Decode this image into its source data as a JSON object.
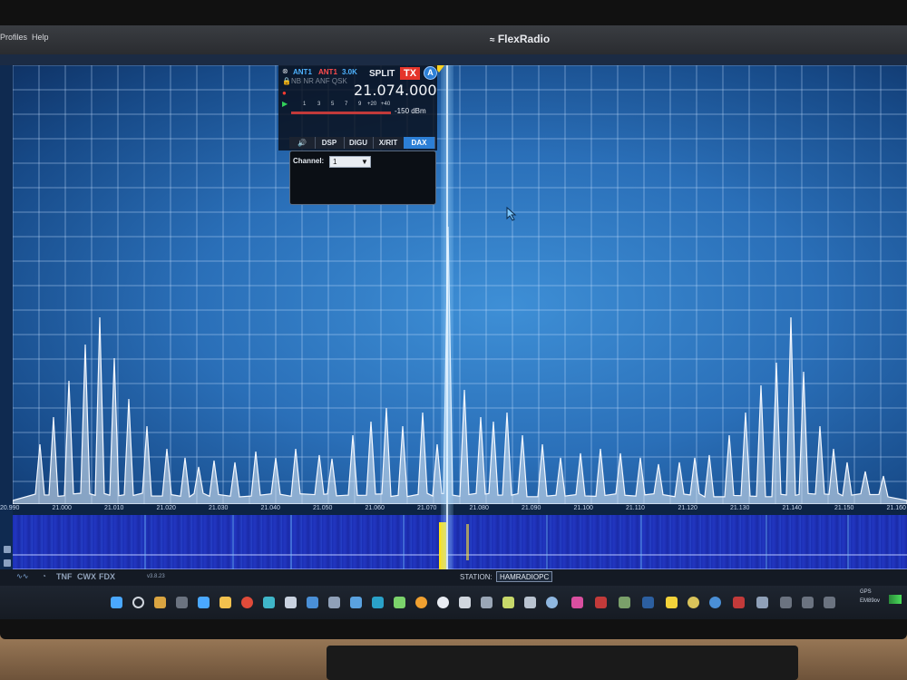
{
  "app": {
    "brand": "FlexRadio",
    "menus": [
      "Profiles",
      "Help"
    ]
  },
  "slice": {
    "rx_ant": "ANT1",
    "tx_ant": "ANT1",
    "filter": "3.0K",
    "flags": "NB NR ANF QSK",
    "split_label": "SPLIT",
    "tx_label": "TX",
    "slice_letter": "A",
    "frequency": "21.074.000",
    "meter_scale": [
      "1",
      "3",
      "5",
      "7",
      "9",
      "+20",
      "+40"
    ],
    "meter_readout": "-150 dBm",
    "tabs": [
      "🔊",
      "DSP",
      "DIGU",
      "X/RIT",
      "DAX"
    ],
    "active_tab": "DAX",
    "dax": {
      "channel_label": "Channel:",
      "channel_value": "1"
    }
  },
  "freq_axis": [
    "20.990",
    "21.000",
    "21.010",
    "21.020",
    "21.030",
    "21.040",
    "21.050",
    "21.060",
    "21.070",
    "21.080",
    "21.090",
    "21.100",
    "21.110",
    "21.120",
    "21.130",
    "21.140",
    "21.150",
    "21.160"
  ],
  "status": {
    "left_items": [
      "TNF",
      "CWX",
      "FDX"
    ],
    "version": "v3.8.23",
    "station_label": "STATION:",
    "station_value": "HAMRADIOPC"
  },
  "tray": {
    "gps": "GPS",
    "grid": "EM89ov"
  },
  "colors": {
    "panadapter": "#2a6fb8",
    "waterfall": "#1a2fb4",
    "signal": "#ffe21a",
    "tx": "#e5352b",
    "dax_tab": "#2c7fd6",
    "marker": "#ffd21e"
  },
  "icons": [
    "windows-icon",
    "search-icon",
    "widgets-icon",
    "chrome-icon",
    "folder-icon",
    "settings-icon"
  ]
}
